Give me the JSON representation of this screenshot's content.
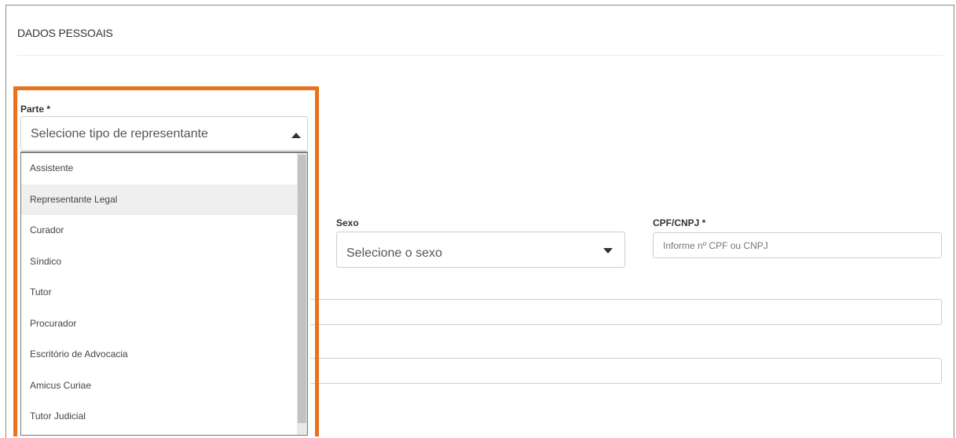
{
  "section": {
    "title": "DADOS PESSOAIS"
  },
  "parte": {
    "label": "Parte *",
    "selected": "Selecione tipo de representante",
    "options": [
      "Assistente",
      "Representante Legal",
      "Curador",
      "Síndico",
      "Tutor",
      "Procurador",
      "Escritório de Advocacia",
      "Amicus Curiae",
      "Tutor Judicial"
    ],
    "highlighted_option": "Representante Legal"
  },
  "sexo": {
    "label": "Sexo",
    "selected": "Selecione o sexo"
  },
  "cpf": {
    "label": "CPF/CNPJ *",
    "placeholder": "Informe nº CPF ou CNPJ"
  },
  "colors": {
    "highlight_border": "#e8721c",
    "panel_border": "#8a8a8a"
  }
}
